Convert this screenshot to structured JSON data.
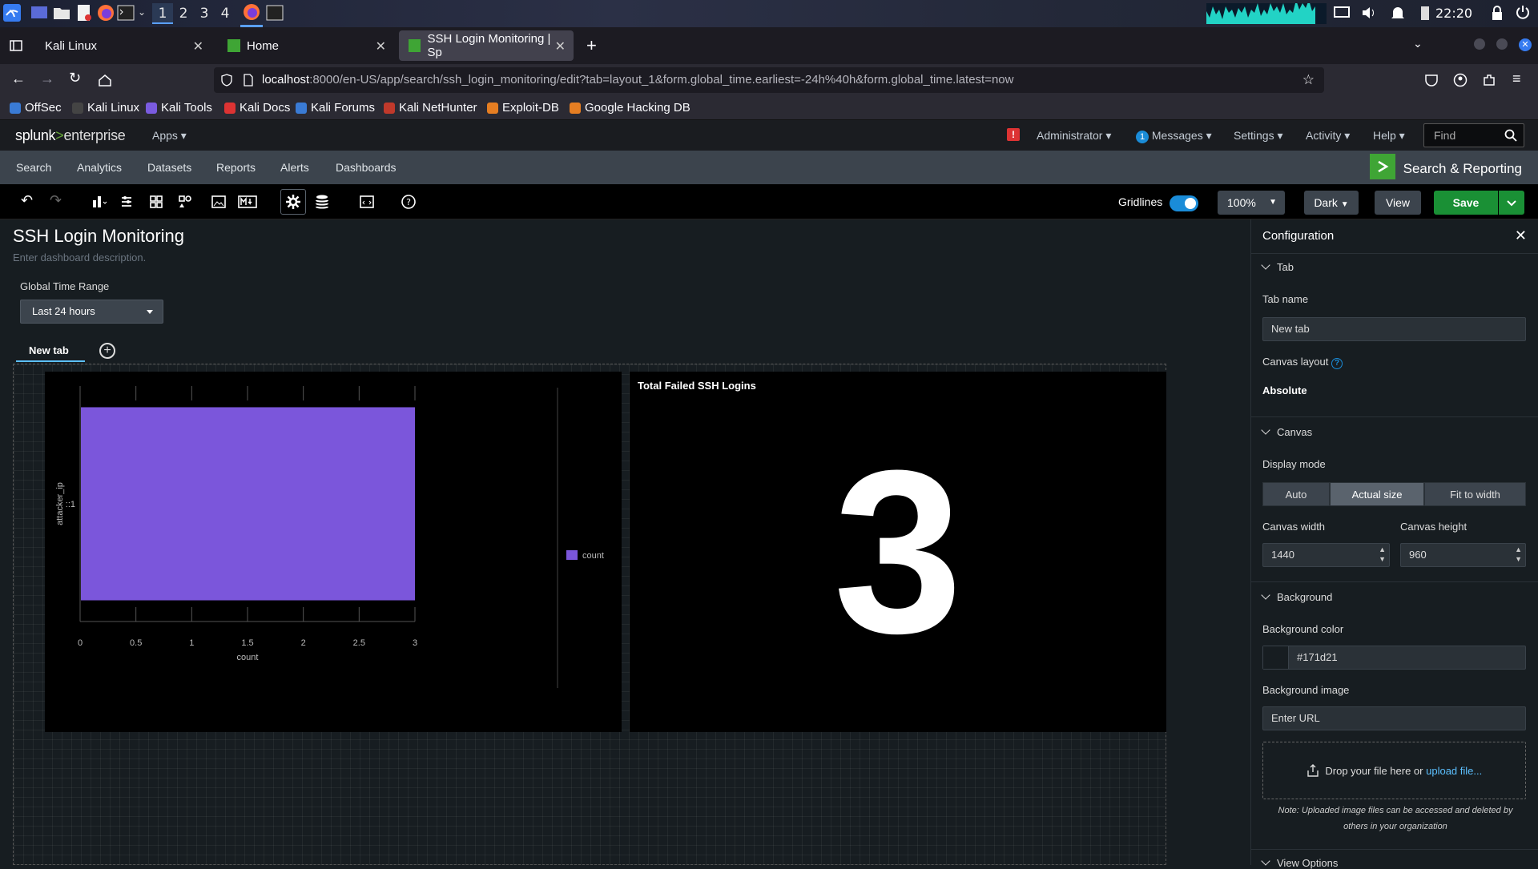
{
  "taskbar": {
    "workspaces": [
      "1",
      "2",
      "3",
      "4"
    ],
    "clock": "22:20"
  },
  "browser": {
    "tabs": [
      {
        "label": "Kali Linux"
      },
      {
        "label": "Home"
      },
      {
        "label": "SSH Login Monitoring | Sp"
      }
    ],
    "url_host": "localhost",
    "url_path": ":8000/en-US/app/search/ssh_login_monitoring/edit?tab=layout_1&form.global_time.earliest=-24h%40h&form.global_time.latest=now",
    "bookmarks": [
      "OffSec",
      "Kali Linux",
      "Kali Tools",
      "Kali Docs",
      "Kali Forums",
      "Kali NetHunter",
      "Exploit-DB",
      "Google Hacking DB"
    ]
  },
  "splunk": {
    "logo_a": "splunk",
    "logo_gt": ">",
    "logo_b": "enterprise",
    "apps": "Apps",
    "user": "Administrator",
    "messages_count": "1",
    "messages": "Messages",
    "settings": "Settings",
    "activity": "Activity",
    "help": "Help",
    "find": "Find",
    "nav": [
      "Search",
      "Analytics",
      "Datasets",
      "Reports",
      "Alerts",
      "Dashboards"
    ],
    "app_name": "Search & Reporting"
  },
  "editor": {
    "gridlines_label": "Gridlines",
    "zoom": "100%",
    "theme": "Dark",
    "view": "View",
    "save": "Save"
  },
  "dashboard": {
    "title": "SSH Login Monitoring",
    "description": "Enter dashboard description.",
    "time_label": "Global Time Range",
    "time_value": "Last 24 hours",
    "tab_name": "New tab",
    "single_value_title": "Total Failed SSH Logins",
    "single_value": "3"
  },
  "chart_data": {
    "type": "bar",
    "orientation": "horizontal",
    "categories": [
      "::1"
    ],
    "series": [
      {
        "name": "count",
        "values": [
          3
        ],
        "color": "#7b56db"
      }
    ],
    "xlabel": "count",
    "ylabel": "attacker_ip",
    "xlim": [
      0,
      3
    ],
    "xticks": [
      "0",
      "0.5",
      "1",
      "1.5",
      "2",
      "2.5",
      "3"
    ],
    "legend": "right"
  },
  "config": {
    "title": "Configuration",
    "tab_section": "Tab",
    "tab_name_label": "Tab name",
    "tab_name_value": "New tab",
    "canvas_layout_label": "Canvas layout",
    "canvas_layout_value": "Absolute",
    "canvas_section": "Canvas",
    "display_mode_label": "Display mode",
    "display_modes": [
      "Auto",
      "Actual size",
      "Fit to width"
    ],
    "canvas_width_label": "Canvas width",
    "canvas_width": "1440",
    "canvas_height_label": "Canvas height",
    "canvas_height": "960",
    "background_section": "Background",
    "bg_color_label": "Background color",
    "bg_color": "#171d21",
    "bg_image_label": "Background image",
    "bg_image_placeholder": "Enter URL",
    "drop_text": "Drop your file here or",
    "upload_link": "upload file...",
    "note": "Note: Uploaded image files can be accessed and deleted by others in your organization",
    "view_options": "View Options"
  }
}
